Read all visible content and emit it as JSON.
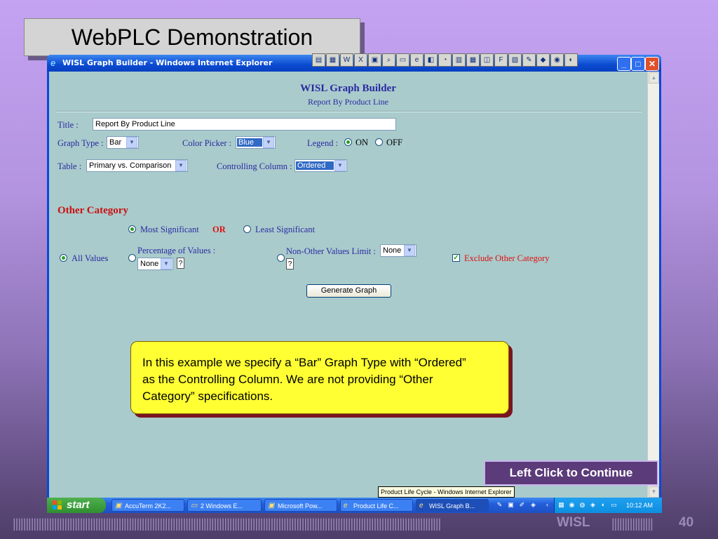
{
  "slide": {
    "title": "WebPLC Demonstration",
    "brand": "WISL",
    "page_number": "40",
    "footer_bars": "||||||||||||||||||||||||||||||||||||||||||||||||||||||||||||||||||||||||||||||||||||||||||||||||||||||||||||||||||||||||||||||||||||||||||||||||||||||||||||||||||||||",
    "footer_bars_right": "||||||||||||||||"
  },
  "window": {
    "title": "WISL Graph Builder - Windows Internet Explorer",
    "minimize": "_",
    "maximize": "□",
    "close": "✕"
  },
  "form": {
    "heading": "WISL Graph Builder",
    "subheading": "Report By Product Line",
    "title_label": "Title :",
    "title_value": "Report By Product Line",
    "graph_type_label": "Graph Type :",
    "graph_type_value": "Bar",
    "color_picker_label": "Color Picker :",
    "color_picker_value": "Blue",
    "legend_label": "Legend :",
    "legend_on": "ON",
    "legend_off": "OFF",
    "table_label": "Table :",
    "table_value": "Primary vs. Comparison",
    "controlling_column_label": "Controlling Column :",
    "controlling_column_value": "Ordered",
    "other_category_heading": "Other Category",
    "most_significant": "Most Significant",
    "or_label": "OR",
    "least_significant": "Least Significant",
    "all_values": "All Values",
    "percentage_label": "Percentage of Values :",
    "percentage_value": "None",
    "non_other_label": "Non-Other Values Limit :",
    "non_other_value": "None",
    "help": "?",
    "exclude_other": "Exclude Other Category",
    "generate_button": "Generate Graph"
  },
  "callout": {
    "text": "In this example we specify a “Bar” Graph Type with “Ordered” as the Controlling Column. We are not providing “Other Category” specifications."
  },
  "continue_button": "Left Click to Continue",
  "tooltip": "Product Life Cycle - Windows Internet Explorer",
  "taskbar": {
    "start": "start",
    "tasks": [
      "AccuTerm 2K2...",
      "2 Windows E...",
      "Microsoft Pow...",
      "Product Life C...",
      "WISL Graph B..."
    ],
    "clock": "10:12 AM"
  },
  "colors": {
    "slide_background": "#b394e0",
    "page_background": "#a9cbcc",
    "label_blue": "#2a2aa0",
    "accent_red": "#e01010",
    "callout_yellow": "#ffff33"
  }
}
